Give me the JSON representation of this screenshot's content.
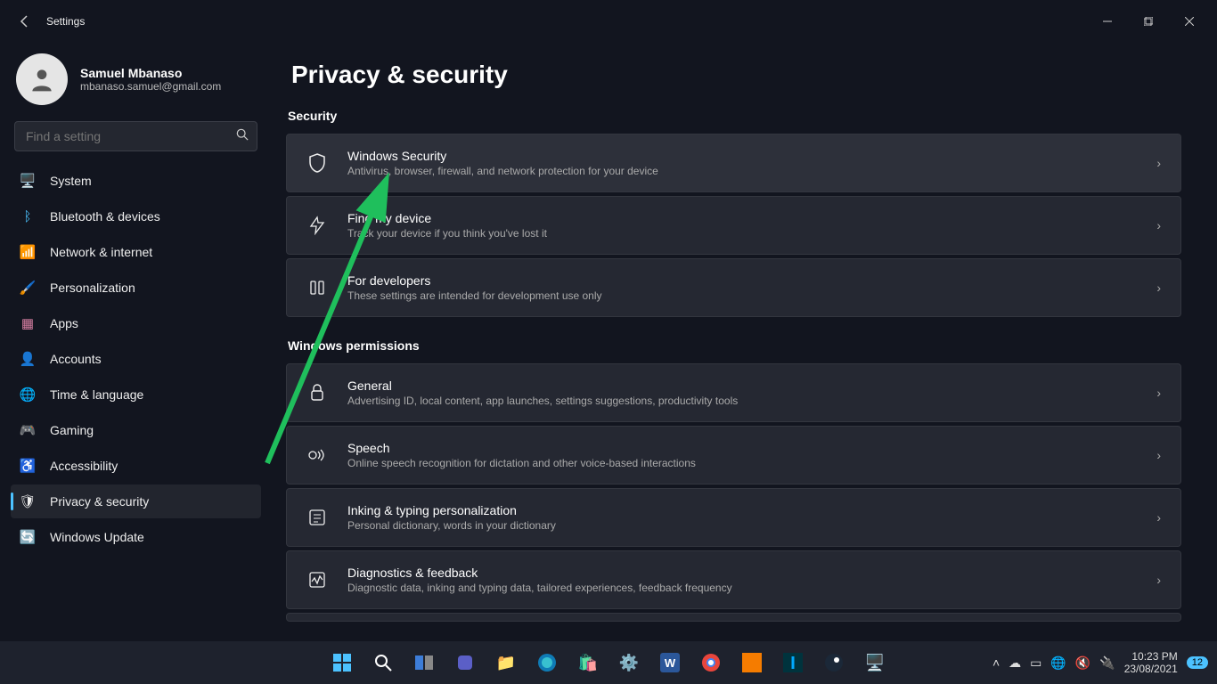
{
  "title_bar": {
    "app_name": "Settings"
  },
  "account": {
    "name": "Samuel Mbanaso",
    "email": "mbanaso.samuel@gmail.com"
  },
  "search": {
    "placeholder": "Find a setting"
  },
  "nav": {
    "items": [
      {
        "label": "System",
        "icon": "🖥️"
      },
      {
        "label": "Bluetooth & devices",
        "icon": "ᛒ"
      },
      {
        "label": "Network & internet",
        "icon": "📶"
      },
      {
        "label": "Personalization",
        "icon": "🖌️"
      },
      {
        "label": "Apps",
        "icon": "▦"
      },
      {
        "label": "Accounts",
        "icon": "👤"
      },
      {
        "label": "Time & language",
        "icon": "🌐"
      },
      {
        "label": "Gaming",
        "icon": "🎮"
      },
      {
        "label": "Accessibility",
        "icon": "♿"
      },
      {
        "label": "Privacy & security",
        "icon": "🛡"
      },
      {
        "label": "Windows Update",
        "icon": "🔄"
      }
    ]
  },
  "page": {
    "title": "Privacy & security",
    "sections": {
      "security": {
        "label": "Security",
        "items": [
          {
            "title": "Windows Security",
            "desc": "Antivirus, browser, firewall, and network protection for your device",
            "icon": "shield"
          },
          {
            "title": "Find my device",
            "desc": "Track your device if you think you've lost it",
            "icon": "location"
          },
          {
            "title": "For developers",
            "desc": "These settings are intended for development use only",
            "icon": "dev"
          }
        ]
      },
      "permissions": {
        "label": "Windows permissions",
        "items": [
          {
            "title": "General",
            "desc": "Advertising ID, local content, app launches, settings suggestions, productivity tools",
            "icon": "lock"
          },
          {
            "title": "Speech",
            "desc": "Online speech recognition for dictation and other voice-based interactions",
            "icon": "speech"
          },
          {
            "title": "Inking & typing personalization",
            "desc": "Personal dictionary, words in your dictionary",
            "icon": "ink"
          },
          {
            "title": "Diagnostics & feedback",
            "desc": "Diagnostic data, inking and typing data, tailored experiences, feedback frequency",
            "icon": "diag"
          }
        ]
      }
    }
  },
  "taskbar": {
    "time": "10:23 PM",
    "date": "23/08/2021",
    "notification_count": "12"
  }
}
